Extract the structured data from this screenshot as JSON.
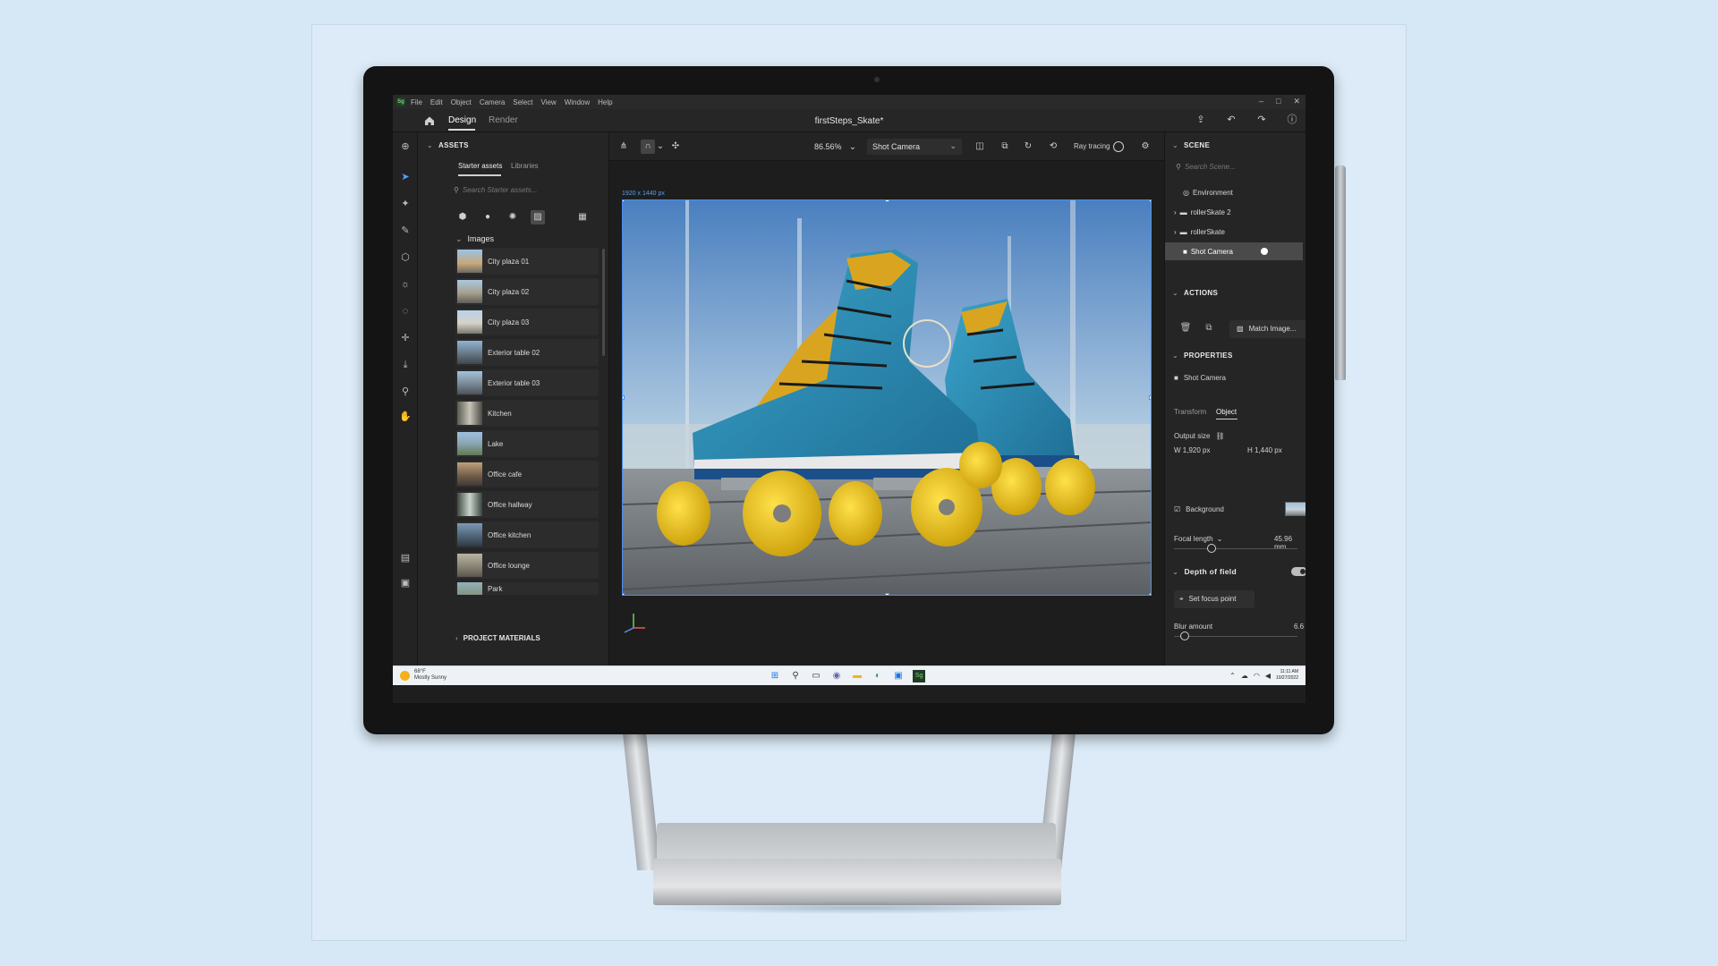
{
  "menu": [
    "File",
    "Edit",
    "Object",
    "Camera",
    "Select",
    "View",
    "Window",
    "Help"
  ],
  "app_logo": "Sg",
  "tabs": [
    "Design",
    "Render"
  ],
  "document_title": "firstSteps_Skate*",
  "assets": {
    "title": "ASSETS",
    "subtabs": [
      "Starter assets",
      "Libraries"
    ],
    "search_placeholder": "Search Starter assets...",
    "group_title": "Images",
    "items": [
      "City plaza 01",
      "City plaza 02",
      "City plaza 03",
      "Exterior table 02",
      "Exterior table 03",
      "Kitchen",
      "Lake",
      "Office cafe",
      "Office hallway",
      "Office kitchen",
      "Office lounge",
      "Park"
    ],
    "project_materials": "PROJECT MATERIALS"
  },
  "toolbar": {
    "zoom": "86.56%",
    "camera": "Shot Camera",
    "ray_tracing_label": "Ray tracing"
  },
  "canvas": {
    "doc_size": "1920 x 1440 px"
  },
  "scene": {
    "title": "SCENE",
    "search_placeholder": "Search Scene...",
    "items": [
      "Environment",
      "rollerSkate 2",
      "rollerSkate",
      "Shot Camera"
    ]
  },
  "actions": {
    "title": "ACTIONS",
    "match_image": "Match Image..."
  },
  "properties": {
    "title": "PROPERTIES",
    "object_name": "Shot Camera",
    "tabs": [
      "Transform",
      "Object"
    ],
    "output_size_label": "Output size",
    "width": "W  1,920 px",
    "height": "H  1,440 px",
    "background_label": "Background",
    "focal_length_label": "Focal length",
    "focal_length_value": "45.96 mm",
    "dof_label": "Depth of field",
    "set_focus_point": "Set focus point",
    "blur_amount_label": "Blur amount",
    "blur_amount_value": "6.6"
  },
  "taskbar": {
    "temperature": "68°F",
    "weather": "Mostly Sunny",
    "time": "11:11 AM",
    "date": "10/27/2022"
  }
}
